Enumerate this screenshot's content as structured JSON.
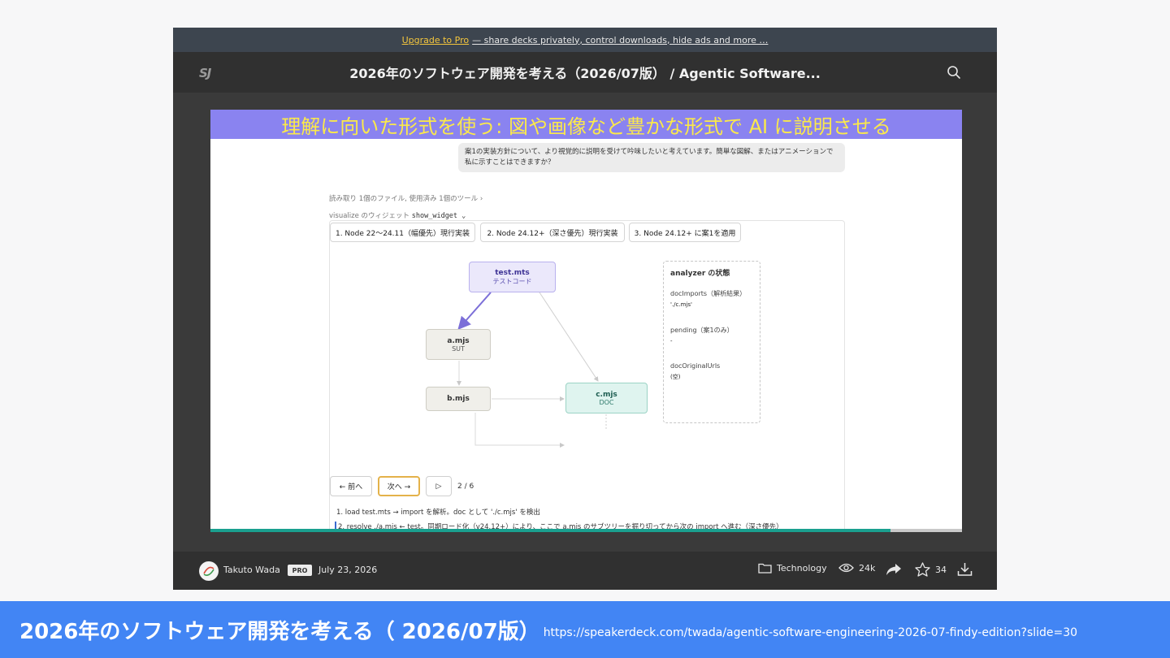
{
  "promo": {
    "link": "Upgrade to Pro",
    "text": "— share decks privately, control downloads, hide ads and more …"
  },
  "topbar": {
    "logo": "SJ",
    "title": "2026年のソフトウェア開発を考える（2026/07版） / Agentic Software..."
  },
  "slide": {
    "heading": "理解に向いた形式を使う: 図や画像など豊かな形式で AI に説明させる",
    "chat_bubble": "案1の実装方針について、より視覚的に説明を受けて吟味したいと考えています。簡単な図解、またはアニメーションで私に示すことはできますか？",
    "read_info": "読み取り 1個のファイル, 使用済み 1個のツール ›",
    "widget_label": "visualize のウィジェット",
    "widget_name": "show_widget ⌄",
    "tabs": [
      "1. Node 22〜24.11（幅優先）現行実装",
      "2. Node 24.12+（深さ優先）現行実装",
      "3. Node 24.12+ に案1を適用"
    ],
    "nodes": {
      "test": {
        "name": "test.mts",
        "sub": "テストコード"
      },
      "a": {
        "name": "a.mjs",
        "sub": "SUT"
      },
      "b": {
        "name": "b.mjs",
        "sub": ""
      },
      "c": {
        "name": "c.mjs",
        "sub": "DOC"
      }
    },
    "state": {
      "title": "analyzer の状態",
      "items": [
        {
          "label": "docImports（解析結果）",
          "value": "'./c.mjs'"
        },
        {
          "label": "pending（案1のみ）",
          "value": "-"
        },
        {
          "label": "docOriginalUrls",
          "value": "(空)"
        }
      ]
    },
    "controls": {
      "prev": "← 前へ",
      "next": "次へ →",
      "play": "▷",
      "page": "2 / 6"
    },
    "steps": [
      "1. load test.mts → import を解析。doc として './c.mjs' を検出",
      "2. resolve ./a.mjs ← test。同期ロード化（v24.12+）により、ここで a.mjs のサブツリーを掘り切ってから次の import へ進む（深さ優先）"
    ],
    "progress": 0.905
  },
  "footer": {
    "author": "Takuto Wada",
    "badge": "PRO",
    "date": "July 23, 2026",
    "category": "Technology",
    "views": "24k",
    "stars": "34"
  },
  "caption": {
    "title": "2026年のソフトウェア開発を考える（ 2026/07版）",
    "url": "https://speakerdeck.com/twada/agentic-software-engineering-2026-07-findy-edition?slide=30"
  },
  "colors": {
    "accent_header": "#8a83f0",
    "header_text": "#fbe94a",
    "caption_bar": "#4285f4",
    "promo_link": "#f4c63d"
  }
}
